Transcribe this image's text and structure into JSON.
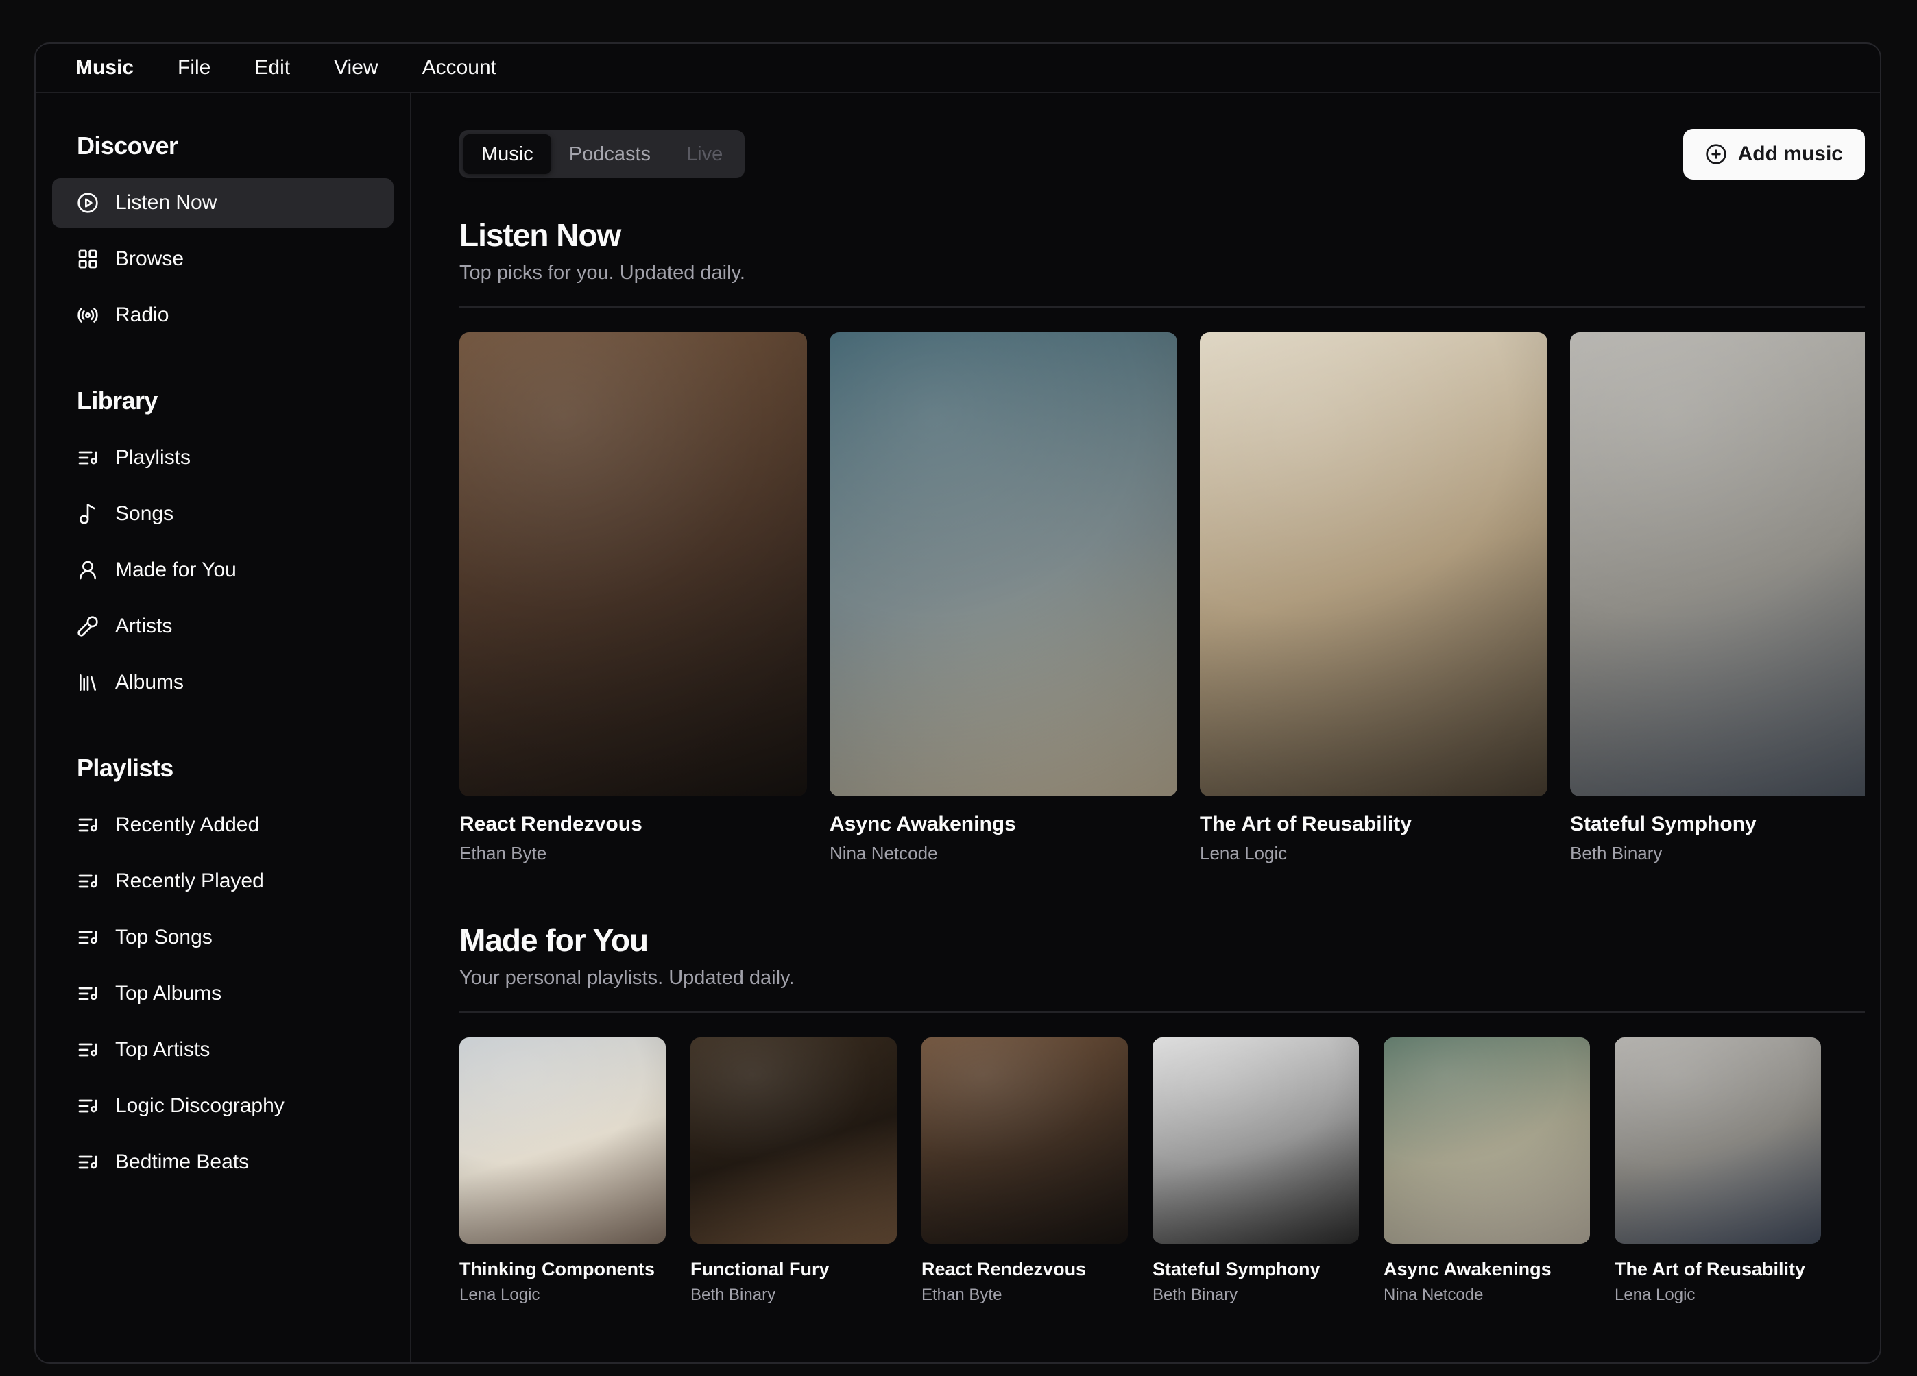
{
  "menubar": {
    "items": [
      {
        "label": "Music"
      },
      {
        "label": "File"
      },
      {
        "label": "Edit"
      },
      {
        "label": "View"
      },
      {
        "label": "Account"
      }
    ]
  },
  "sidebar": {
    "sections": [
      {
        "title": "Discover",
        "items": [
          {
            "label": "Listen Now",
            "icon": "play-circle",
            "active": true
          },
          {
            "label": "Browse",
            "icon": "layout-grid",
            "active": false
          },
          {
            "label": "Radio",
            "icon": "radio",
            "active": false
          }
        ]
      },
      {
        "title": "Library",
        "items": [
          {
            "label": "Playlists",
            "icon": "list-music",
            "active": false
          },
          {
            "label": "Songs",
            "icon": "music-note",
            "active": false
          },
          {
            "label": "Made for You",
            "icon": "user-round",
            "active": false
          },
          {
            "label": "Artists",
            "icon": "microphone",
            "active": false
          },
          {
            "label": "Albums",
            "icon": "library",
            "active": false
          }
        ]
      },
      {
        "title": "Playlists",
        "items": [
          {
            "label": "Recently Added",
            "icon": "list-music",
            "active": false
          },
          {
            "label": "Recently Played",
            "icon": "list-music",
            "active": false
          },
          {
            "label": "Top Songs",
            "icon": "list-music",
            "active": false
          },
          {
            "label": "Top Albums",
            "icon": "list-music",
            "active": false
          },
          {
            "label": "Top Artists",
            "icon": "list-music",
            "active": false
          },
          {
            "label": "Logic Discography",
            "icon": "list-music",
            "active": false
          },
          {
            "label": "Bedtime Beats",
            "icon": "list-music",
            "active": false
          }
        ]
      }
    ]
  },
  "header": {
    "tabs": [
      {
        "label": "Music",
        "state": "active"
      },
      {
        "label": "Podcasts",
        "state": "default"
      },
      {
        "label": "Live",
        "state": "disabled"
      }
    ],
    "add_button": {
      "label": "Add music",
      "icon": "plus-circle"
    }
  },
  "sections": [
    {
      "title": "Listen Now",
      "subtitle": "Top picks for you. Updated daily.",
      "card_size": "large",
      "cards": [
        {
          "title": "React Rendezvous",
          "artist": "Ethan Byte",
          "art_desc": "woman-headphones-writing-bookshelf",
          "art": [
            "#6e513a",
            "#453226",
            "#191411"
          ]
        },
        {
          "title": "Async Awakenings",
          "artist": "Nina Netcode",
          "art_desc": "blonde-woman-headphones-window",
          "art": [
            "#40626f",
            "#7a878a",
            "#c4b79d"
          ]
        },
        {
          "title": "The Art of Reusability",
          "artist": "Lena Logic",
          "art_desc": "saxophonist-street",
          "art": [
            "#ded5c2",
            "#ae9b7d",
            "#4e4335"
          ]
        },
        {
          "title": "Stateful Symphony",
          "artist": "Beth Binary",
          "art_desc": "guitarist-street-busker",
          "art": [
            "#b5b3ae",
            "#8e8c86",
            "#4c5460"
          ]
        }
      ]
    },
    {
      "title": "Made for You",
      "subtitle": "Your personal playlists. Updated daily.",
      "card_size": "small",
      "cards": [
        {
          "title": "Thinking Components",
          "artist": "Lena Logic",
          "art_desc": "two-models-white-outfits",
          "art": [
            "#c8cdd1",
            "#e2dbcd",
            "#8d7a6b"
          ]
        },
        {
          "title": "Functional Fury",
          "artist": "Beth Binary",
          "art_desc": "pianist-record-shelves",
          "art": [
            "#3a2d20",
            "#211912",
            "#77593f"
          ]
        },
        {
          "title": "React Rendezvous",
          "artist": "Ethan Byte",
          "art_desc": "woman-headphones-bookshelf",
          "art": [
            "#6e513a",
            "#3f2f23",
            "#1a1512"
          ]
        },
        {
          "title": "Stateful Symphony",
          "artist": "Beth Binary",
          "art_desc": "bw-woman-fire-escape",
          "art": [
            "#dcdcdc",
            "#979797",
            "#2e2e2e"
          ]
        },
        {
          "title": "Async Awakenings",
          "artist": "Nina Netcode",
          "art_desc": "blonde-woman-reflection",
          "art": [
            "#5b7566",
            "#a4a18b",
            "#c8bfae"
          ]
        },
        {
          "title": "The Art of Reusability",
          "artist": "Lena Logic",
          "art_desc": "guitarist-street-busker",
          "art": [
            "#b0aeaa",
            "#878580",
            "#475061"
          ]
        }
      ]
    }
  ],
  "colors": {
    "page_bg": "#0b0b0c",
    "window_bg": "#09090b",
    "border": "#26262b",
    "active_item_bg": "#28282c",
    "tabs_bg": "#27272b",
    "muted_text": "#a1a1aa",
    "button_bg": "#fafafa",
    "button_text": "#17171a"
  }
}
